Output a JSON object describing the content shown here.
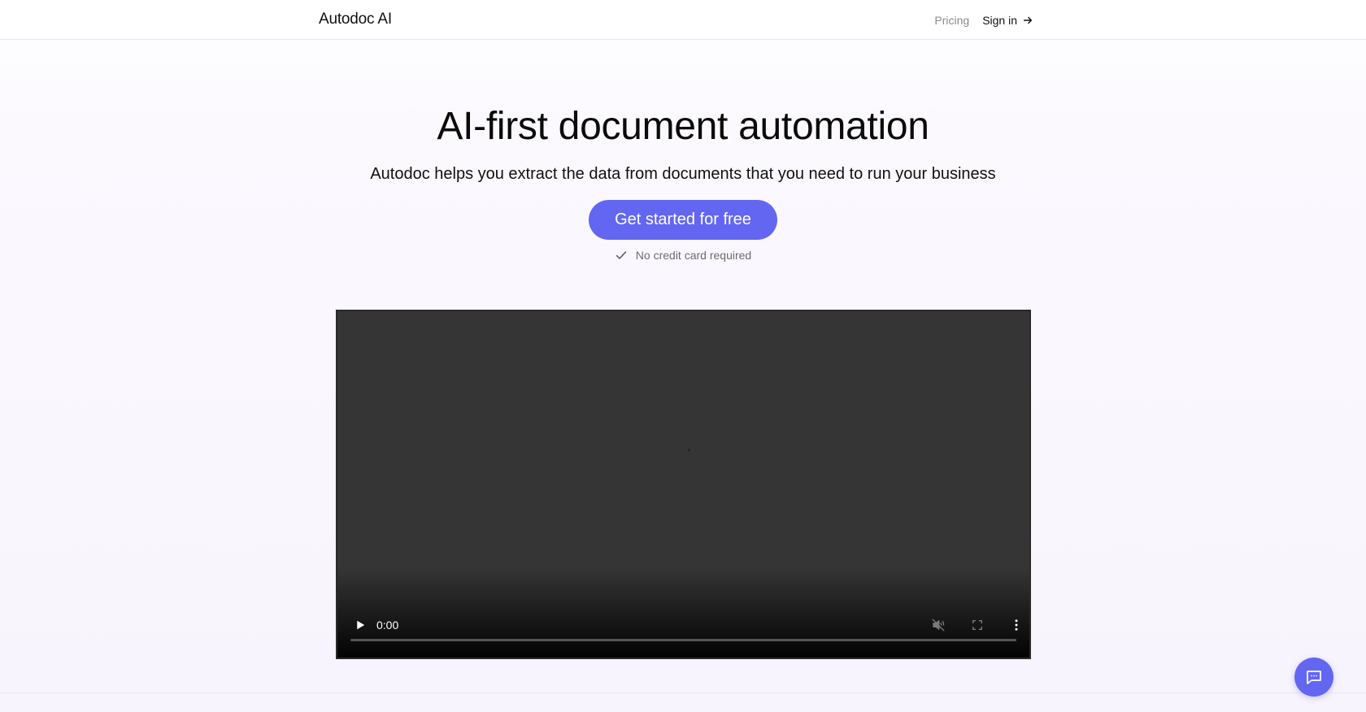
{
  "header": {
    "brand": "Autodoc AI",
    "nav": {
      "pricing_label": "Pricing",
      "signin_label": "Sign in",
      "signin_icon": "arrow-right-icon"
    }
  },
  "hero": {
    "title": "AI-first document automation",
    "subtitle": "Autodoc helps you extract the data from documents that you need to run your business",
    "cta_label": "Get started for free",
    "note_icon": "check-icon",
    "note_text": "No credit card required"
  },
  "video": {
    "current_time": "0:00",
    "progress": 0,
    "muted": true,
    "icons": [
      "play-icon",
      "muted-speaker-icon",
      "fullscreen-icon",
      "more-vertical-icon"
    ]
  },
  "chat": {
    "icon": "chat-bubble-icon"
  },
  "colors": {
    "accent": "#6366f1",
    "video_bg": "#353535"
  }
}
